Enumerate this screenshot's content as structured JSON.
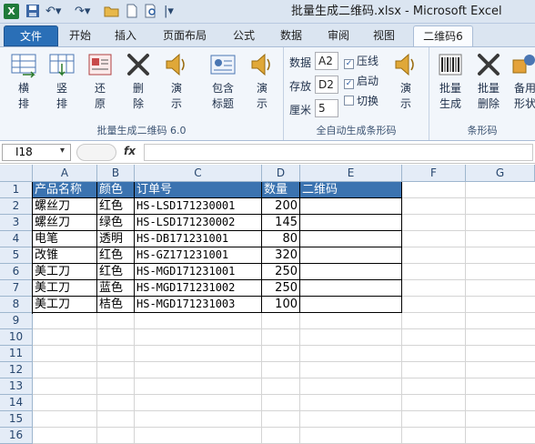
{
  "window": {
    "title": "批量生成二维码.xlsx  -  Microsoft Excel"
  },
  "tabs": [
    "文件",
    "开始",
    "插入",
    "页面布局",
    "公式",
    "数据",
    "审阅",
    "视图",
    "二维码6"
  ],
  "ribbon": {
    "group1": {
      "label": "批量生成二维码 6.0",
      "buttons": [
        "横排",
        "竖排",
        "还原",
        "删除",
        "演示",
        "包含标题",
        "演示"
      ]
    },
    "group2": {
      "label": "全自动生成条形码",
      "data_label": "数据",
      "data_value": "A2",
      "store_label": "存放",
      "store_value": "D2",
      "cm_label": "厘米",
      "cm_value": "5",
      "chk_line": "压线",
      "chk_start": "启动",
      "chk_switch": "切换",
      "demo": "演示"
    },
    "group3": {
      "label": "条形码",
      "buttons": [
        "批量生成",
        "批量删除",
        "备用形状"
      ]
    }
  },
  "formula_bar": {
    "name_box": "I18",
    "fx": "fx",
    "content": ""
  },
  "columns": [
    "A",
    "B",
    "C",
    "D",
    "E",
    "F",
    "G"
  ],
  "rows": [
    "1",
    "2",
    "3",
    "4",
    "5",
    "6",
    "7",
    "8",
    "9",
    "10",
    "11",
    "12",
    "13",
    "14",
    "15",
    "16"
  ],
  "table": {
    "headers": [
      "产品名称",
      "颜色",
      "订单号",
      "数量",
      "二维码"
    ],
    "data": [
      [
        "螺丝刀",
        "红色",
        "HS-LSD171230001",
        "200",
        ""
      ],
      [
        "螺丝刀",
        "绿色",
        "HS-LSD171230002",
        "145",
        ""
      ],
      [
        "电笔",
        "透明",
        "HS-DB171231001",
        "80",
        ""
      ],
      [
        "改锥",
        "红色",
        "HS-GZ171231001",
        "320",
        ""
      ],
      [
        "美工刀",
        "红色",
        "HS-MGD171231001",
        "250",
        ""
      ],
      [
        "美工刀",
        "蓝色",
        "HS-MGD171231002",
        "250",
        ""
      ],
      [
        "美工刀",
        "桔色",
        "HS-MGD171231003",
        "100",
        ""
      ]
    ]
  },
  "colors": {
    "header_fill": "#3b73b0",
    "file_tab": "#2a6fb7",
    "excel_green": "#1f7a3a"
  }
}
